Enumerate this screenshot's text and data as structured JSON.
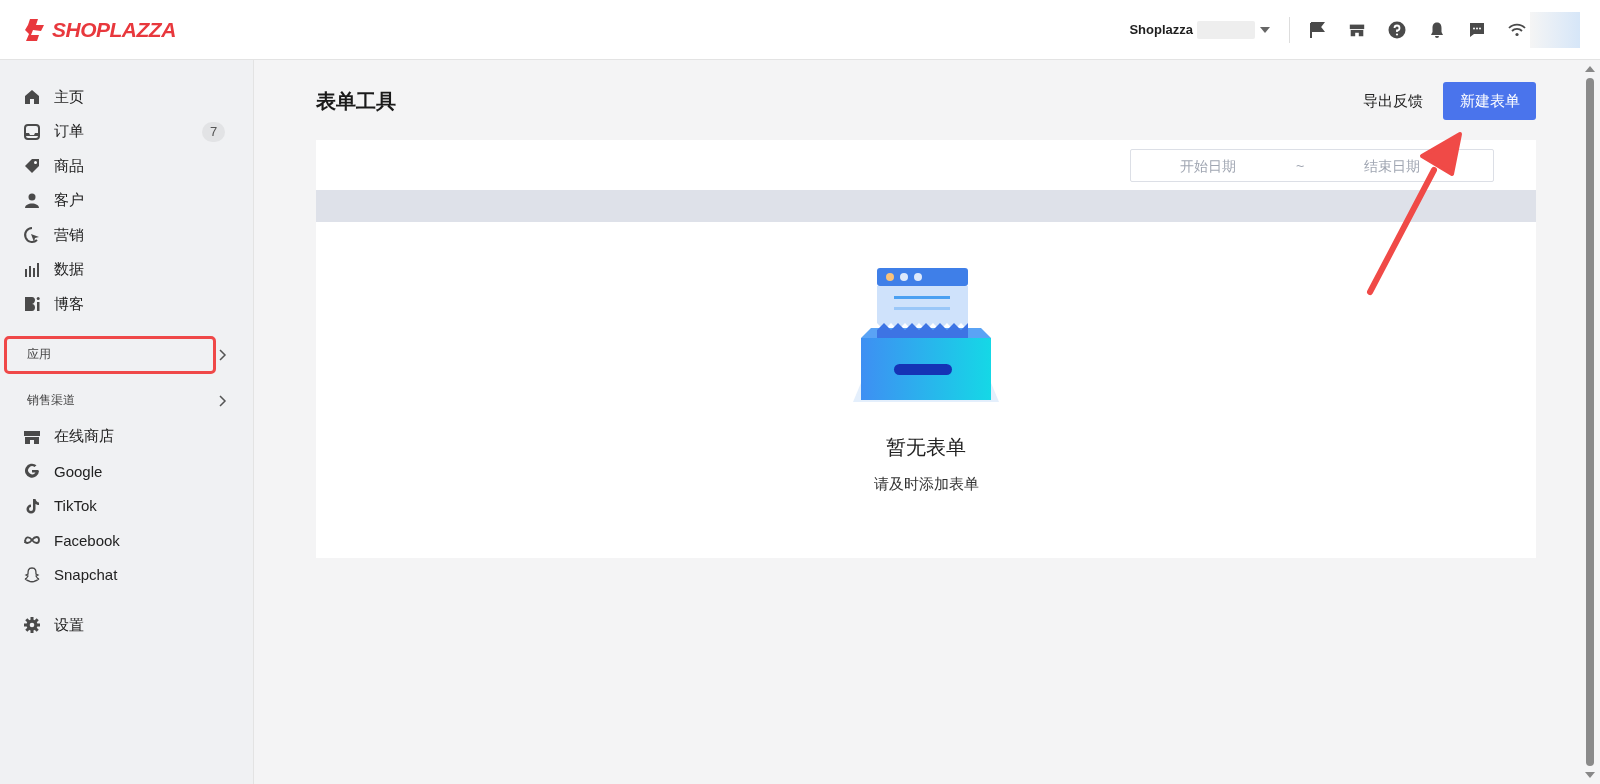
{
  "header": {
    "logo": "SHOPLAZZA",
    "store_name": "Shoplazza"
  },
  "sidebar": {
    "items": [
      {
        "label": "主页"
      },
      {
        "label": "订单",
        "badge": "7"
      },
      {
        "label": "商品"
      },
      {
        "label": "客户"
      },
      {
        "label": "营销"
      },
      {
        "label": "数据"
      },
      {
        "label": "博客"
      }
    ],
    "apps": {
      "label": "应用",
      "highlighted": true
    },
    "channels": {
      "label": "销售渠道",
      "items": [
        {
          "label": "在线商店"
        },
        {
          "label": "Google"
        },
        {
          "label": "TikTok"
        },
        {
          "label": "Facebook"
        },
        {
          "label": "Snapchat"
        }
      ]
    },
    "settings": {
      "label": "设置"
    }
  },
  "page": {
    "title": "表单工具",
    "export_link": "导出反馈",
    "new_button": "新建表单",
    "date_range": {
      "start_placeholder": "开始日期",
      "separator": "~",
      "end_placeholder": "结束日期"
    },
    "empty_state": {
      "title": "暂无表单",
      "hint": "请及时添加表单"
    },
    "annotation_arrow": true
  }
}
